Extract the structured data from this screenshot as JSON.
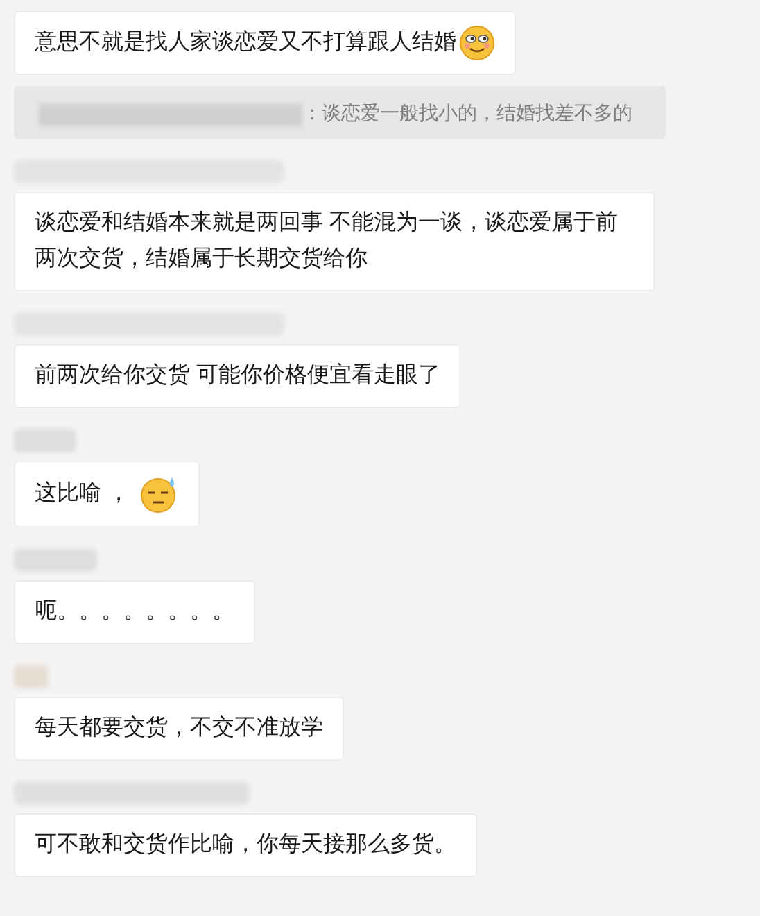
{
  "messages": [
    {
      "kind": "smile",
      "text": "意思不就是找人家谈恋爱又不打算跟人结婚",
      "quote": {
        "text": "：谈恋爱一般找小的，结婚找差不多的"
      }
    },
    {
      "kind": "plain",
      "text": "谈恋爱和结婚本来就是两回事  不能混为一谈，谈恋爱属于前两次交货，结婚属于长期交货给你"
    },
    {
      "kind": "plain",
      "text": "前两次给你交货  可能你价格便宜看走眼了"
    },
    {
      "kind": "sweat",
      "text": "这比喻 ，"
    },
    {
      "kind": "plain",
      "text": "呃。。。。。。。。"
    },
    {
      "kind": "plain",
      "text": "每天都要交货，不交不准放学"
    },
    {
      "kind": "plain",
      "text": "可不敢和交货作比喻，你每天接那么多货。"
    }
  ]
}
